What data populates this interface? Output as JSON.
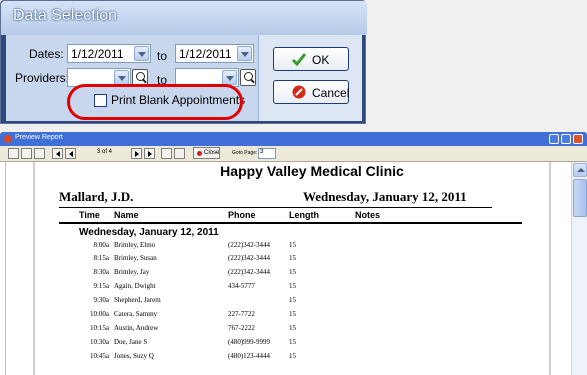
{
  "dialog": {
    "title": "Data Selection",
    "dates_label": "Dates:",
    "date_from": "1/12/2011",
    "to_label": "to",
    "date_to": "1/12/2011",
    "providers_label": "Providers:",
    "provider_from": "",
    "provider_to": "",
    "print_blank_label": "Print Blank Appointments",
    "print_blank_checked": false,
    "ok_label": "OK",
    "cancel_label": "Cancel"
  },
  "preview": {
    "window_title": "Preview Report",
    "page_indicator": "3 of 4",
    "close_label": "Close",
    "goto_label": "Goto Page:",
    "goto_value": "3",
    "report": {
      "clinic_name": "Happy Valley Medical Clinic",
      "provider": "Mallard, J.D.",
      "date_heading": "Wednesday,  January  12,  2011",
      "columns": {
        "time": "Time",
        "name": "Name",
        "phone": "Phone",
        "length": "Length",
        "notes": "Notes"
      },
      "day_section": "Wednesday, January 12, 2011",
      "rows": [
        {
          "time": "8:00a",
          "name": "Brimley, Elmo",
          "phone": "(222)342-3444",
          "length": "15"
        },
        {
          "time": "8:15a",
          "name": "Brimley, Susan",
          "phone": "(222)342-3444",
          "length": "15"
        },
        {
          "time": "8:30a",
          "name": "Brimley, Jay",
          "phone": "(222)342-3444",
          "length": "15"
        },
        {
          "time": "9:15a",
          "name": "Again, Dwight",
          "phone": "434-5777",
          "length": "15"
        },
        {
          "time": "9:30a",
          "name": "Shepherd, Jarem",
          "phone": "",
          "length": "15"
        },
        {
          "time": "10:00a",
          "name": "Catera, Sammy",
          "phone": "227-7722",
          "length": "15"
        },
        {
          "time": "10:15a",
          "name": "Austin, Andrew",
          "phone": "767-2222",
          "length": "15"
        },
        {
          "time": "10:30a",
          "name": "Doe, Jane S",
          "phone": "(480)999-9999",
          "length": "15"
        },
        {
          "time": "10:45a",
          "name": "Jones, Suzy Q",
          "phone": "(480)123-4444",
          "length": "15"
        }
      ]
    }
  },
  "colors": {
    "dialog_frame": "#2e4a7c",
    "title_bar": "#3f6fd7",
    "highlight_oval": "#e00000"
  }
}
